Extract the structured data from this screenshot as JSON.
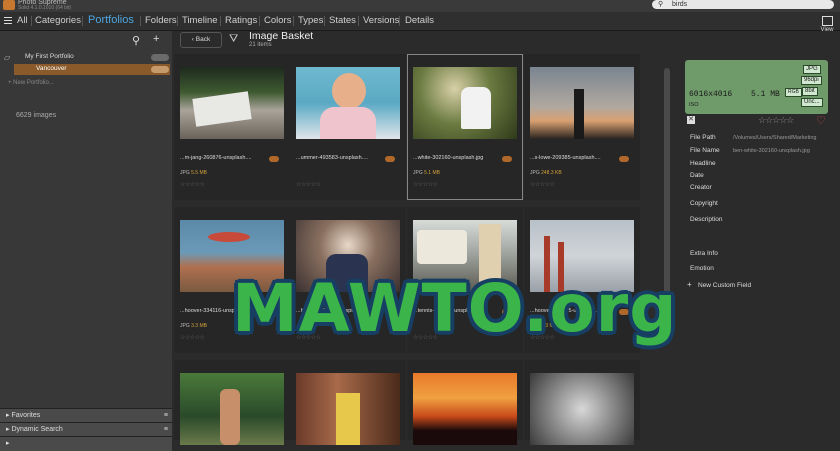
{
  "app": {
    "name": "Photo Supreme",
    "version": "Solid 4.1.0.1010 (64 bit)"
  },
  "search": {
    "value": "birds"
  },
  "nav": {
    "items": [
      "All",
      "Categories",
      "Portfolios",
      "Folders",
      "Timeline",
      "Ratings",
      "Colors",
      "Types",
      "States",
      "Versions",
      "Details"
    ],
    "active": "Portfolios"
  },
  "view_label": "View",
  "sidebar": {
    "portfolio": "My First Portfolio",
    "selected": "Vancouver",
    "new_portfolio": "+ New Portfolio...",
    "count": "6629 images",
    "bottom_panels": [
      {
        "label": "Favorites"
      },
      {
        "label": "Dynamic Search"
      },
      {
        "label": ""
      }
    ]
  },
  "toolbar": {
    "back_label": "Back",
    "title": "Image Basket",
    "subtitle": "21 items"
  },
  "grid": {
    "items": [
      {
        "name": "...m-jang-260876-unsplash....",
        "type": "JPG",
        "size": "5.5 MB"
      },
      {
        "name": "...ummer-493583-unsplash....",
        "type": "",
        "size": ""
      },
      {
        "name": "...white-302160-unsplash.jpg",
        "type": "JPG",
        "size": "5.1 MB"
      },
      {
        "name": "...s-lowe-209385-unsplash....",
        "type": "JPG",
        "size": "248.3 KB"
      },
      {
        "name": "...hoover-334116-unsplash....",
        "type": "JPG",
        "size": "3.3 MB"
      },
      {
        "name": "...hoover-356903-unsplash....",
        "type": "",
        "size": ""
      },
      {
        "name": "...tennis-550019-unsplash....",
        "type": "",
        "size": ""
      },
      {
        "name": "...hoover-332475-unsplash....",
        "type": "JPG",
        "size": "3.3 MB"
      },
      {
        "name": "",
        "type": "",
        "size": ""
      },
      {
        "name": "",
        "type": "",
        "size": ""
      },
      {
        "name": "",
        "type": "",
        "size": ""
      },
      {
        "name": "",
        "type": "",
        "size": ""
      }
    ]
  },
  "inspector": {
    "preview": {
      "dimensions": "6016x4016",
      "size": "5.1 MB",
      "format": "JPG",
      "dpi": "96dpi",
      "bits": "8bit",
      "mode": "RGB",
      "colorspace": "Unc...",
      "iso": "ISO"
    },
    "fields": [
      {
        "label": "File Path",
        "value": "/Volumes/Users/Shared/Marketing"
      },
      {
        "label": "File Name",
        "value": "ben-white-302160-unsplash.jpg"
      },
      {
        "label": "Headline",
        "value": ""
      },
      {
        "label": "Date",
        "value": ""
      },
      {
        "label": "Creator",
        "value": ""
      },
      {
        "label": "Copyright",
        "value": ""
      },
      {
        "label": "Description",
        "value": ""
      },
      {
        "label": "Extra Info",
        "value": ""
      },
      {
        "label": "Emotion",
        "value": ""
      }
    ],
    "new_field": "New Custom Field"
  },
  "watermark": "MAWTO.org"
}
